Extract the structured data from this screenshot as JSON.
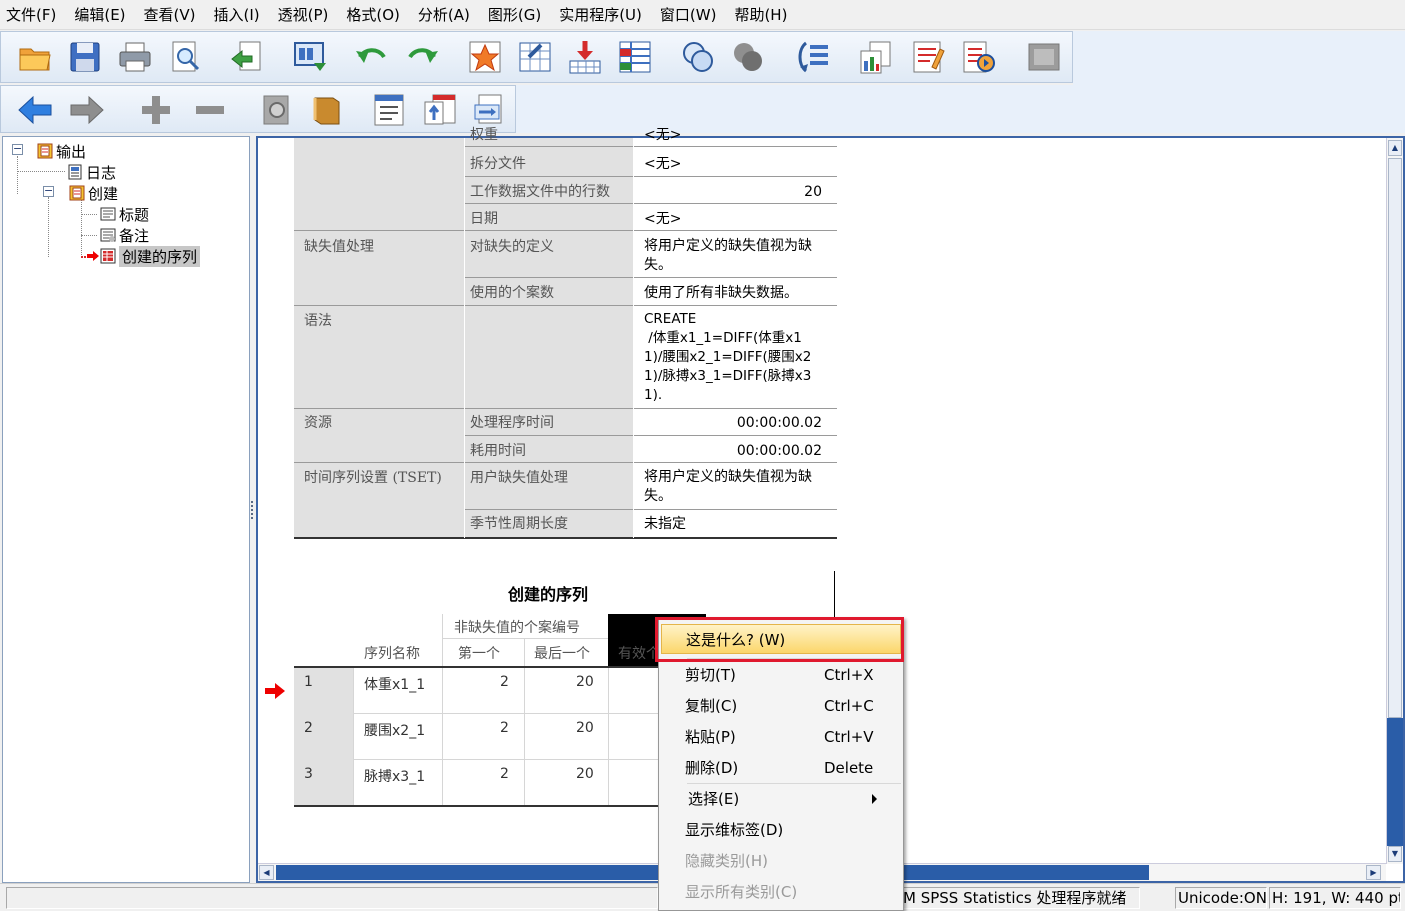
{
  "menubar": {
    "items": [
      "文件(F)",
      "编辑(E)",
      "查看(V)",
      "插入(I)",
      "透视(P)",
      "格式(O)",
      "分析(A)",
      "图形(G)",
      "实用程序(U)",
      "窗口(W)",
      "帮助(H)"
    ]
  },
  "toolbar": {
    "row1": [
      "open-icon",
      "save-icon",
      "print-icon",
      "print-preview-icon",
      "export-icon",
      "recall-dialog-icon",
      "undo-icon",
      "redo-icon",
      "goto-data-icon",
      "goto-case-icon",
      "goto-variable-icon",
      "variables-icon",
      "split-file-icon",
      "select-cases-icon",
      "weight-cases-icon",
      "designate-window-icon",
      "pivot-table-icon",
      "chart-icon",
      "edit-output-icon",
      "disabled-icon"
    ],
    "row2": [
      "back-arrow-icon",
      "forward-arrow-icon",
      "expand-icon",
      "collapse-icon",
      "show-icon",
      "hide-icon",
      "insert-heading-icon",
      "insert-title-icon",
      "insert-text-icon"
    ]
  },
  "tree": {
    "nodes": [
      {
        "label": "输出",
        "icon": "output-book-icon"
      },
      {
        "label": "日志",
        "icon": "log-icon"
      },
      {
        "label": "创建",
        "icon": "output-book-icon"
      },
      {
        "label": "标题",
        "icon": "title-icon"
      },
      {
        "label": "备注",
        "icon": "notes-icon"
      },
      {
        "label": "创建的序列",
        "icon": "table-icon"
      }
    ]
  },
  "info_table": {
    "partial_top": "<无>",
    "rows": [
      {
        "c1": "",
        "c2": "拆分文件",
        "c3": "<无>"
      },
      {
        "c1": "",
        "c2": "工作数据文件中的行数",
        "c3": "20"
      },
      {
        "c1": "",
        "c2": "日期",
        "c3": "<无>"
      },
      {
        "c1": "缺失值处理",
        "c2": "对缺失的定义",
        "c3": "将用户定义的缺失值视为缺失。"
      },
      {
        "c1": "",
        "c2": "使用的个案数",
        "c3": "使用了所有非缺失数据。"
      },
      {
        "c1": "语法",
        "c2": "",
        "c3": "CREATE\n /体重x1_1=DIFF(体重x1 1)/腰围x2_1=DIFF(腰围x2 1)/脉搏x3_1=DIFF(脉搏x3 1)."
      },
      {
        "c1": "资源",
        "c2": "处理程序时间",
        "c3": "00:00:00.02"
      },
      {
        "c1": "",
        "c2": "耗用时间",
        "c3": "00:00:00.02"
      },
      {
        "c1": "时间序列设置 (TSET)",
        "c2": "用户缺失值处理",
        "c3": "将用户定义的缺失值视为缺失。"
      },
      {
        "c1": "",
        "c2": "季节性周期长度",
        "c3": "未指定"
      }
    ]
  },
  "series_table": {
    "title": "创建的序列",
    "group_header": "非缺失值的个案编号",
    "col_name": "序列名称",
    "col_first": "第一个",
    "col_last": "最后一个",
    "col_valid": "有效个",
    "rows": [
      {
        "n": "1",
        "name": "体重x1_1",
        "first": "2",
        "last": "20"
      },
      {
        "n": "2",
        "name": "腰围x2_1",
        "first": "2",
        "last": "20"
      },
      {
        "n": "3",
        "name": "脉搏x3_1",
        "first": "2",
        "last": "20"
      }
    ]
  },
  "context_menu": {
    "items": [
      {
        "label": "这是什么? (W)",
        "shortcut": ""
      },
      {
        "label": "剪切(T)",
        "shortcut": "Ctrl+X"
      },
      {
        "label": "复制(C)",
        "shortcut": "Ctrl+C"
      },
      {
        "label": "粘贴(P)",
        "shortcut": "Ctrl+V"
      },
      {
        "label": "删除(D)",
        "shortcut": "Delete"
      },
      {
        "label": "选择(E)",
        "shortcut": ""
      },
      {
        "label": "显示维标签(D)",
        "shortcut": ""
      },
      {
        "label": "隐藏类别(H)",
        "shortcut": ""
      },
      {
        "label": "显示所有类别(C)",
        "shortcut": ""
      }
    ]
  },
  "statusbar": {
    "main": "",
    "processor": "M SPSS Statistics 处理程序就绪",
    "unicode": "Unicode:ON",
    "dims": "H: 191, W: 440 pt."
  },
  "colors": {
    "accent": "#3c64a6",
    "highlight_border": "#e0192e",
    "menu_hover": "#fbd66b",
    "table_shade": "#e1e1e1"
  }
}
